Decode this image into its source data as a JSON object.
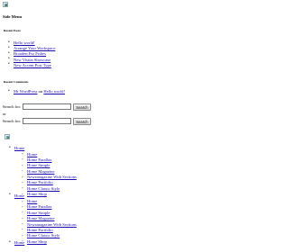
{
  "sidebar": {
    "title": "Side Menu",
    "recent_posts": {
      "title": "Recent Posts",
      "items": [
        "Hello world!",
        "Arrange Your Workspace",
        "Broaden Fur Fishes",
        "New Vision Showcase",
        "New Accent Post Type"
      ]
    },
    "recent_comments": {
      "title": "Recent Comments",
      "author": "Mr WordPress",
      "connector": "on",
      "post": "Hello world!"
    },
    "search": {
      "label": "Search for:",
      "button": "Search",
      "or": "or"
    }
  },
  "nav": {
    "top_label": "Home",
    "sub_items": [
      "Home",
      "Home Parallax",
      "Home Simple",
      "Home Magazine",
      "Newsmagazine With Sections",
      "Home Portfolio",
      "Home Classic Style",
      "Home Shop"
    ]
  }
}
